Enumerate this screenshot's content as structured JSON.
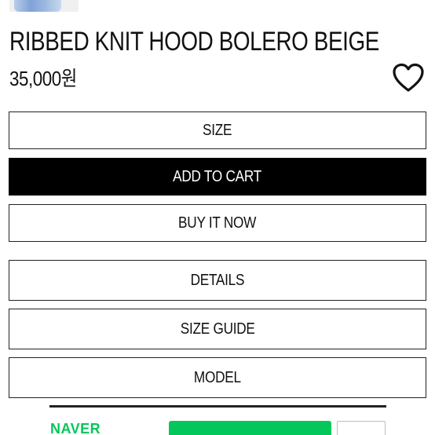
{
  "product": {
    "name": "RIBBED KNIT HOOD BOLERO BEIGE",
    "price": "35,000원"
  },
  "buttons": {
    "size": "SIZE",
    "add_to_cart": "ADD TO CART",
    "buy_now": "BUY IT NOW",
    "details": "DETAILS",
    "size_guide": "SIZE GUIDE",
    "model": "MODEL"
  },
  "naver_pay": {
    "brand": "NAVER",
    "accent": "#03c75a"
  },
  "icons": {
    "wishlist": "heart-icon"
  }
}
